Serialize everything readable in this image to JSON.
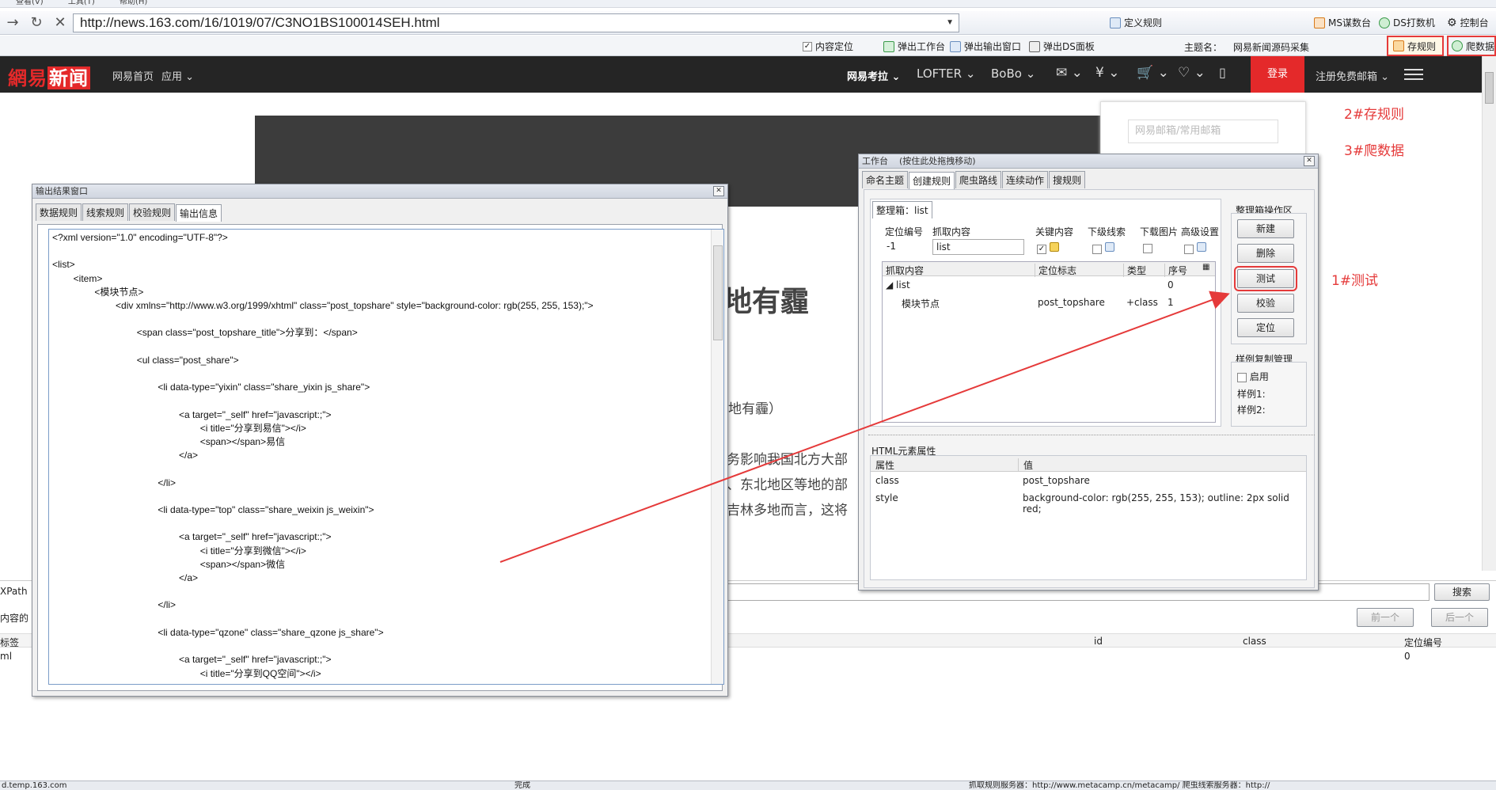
{
  "browser": {
    "menu_items": [
      "查看(V)",
      "工具(T)",
      "帮助(H)"
    ],
    "url": "http://news.163.com/16/1019/07/C3NO1BS100014SEH.html",
    "right_actions": [
      "定义规则",
      "MS谋数台",
      "DS打数机",
      "控制台"
    ],
    "toolbar2": {
      "content_locate": "内容定位",
      "popup_workbench": "弹出工作台",
      "popup_output": "弹出输出窗口",
      "popup_ds": "弹出DS面板",
      "theme_label": "主题名：",
      "theme_value": "网易新闻源码采集",
      "save_rule": "存规则",
      "crawl_data": "爬数据"
    }
  },
  "netease": {
    "logo_a": "網易",
    "logo_b": "新闻",
    "nav_left": [
      "网易首页",
      "应用"
    ],
    "nav_right": [
      "网易考拉",
      "LOFTER",
      "BoBo"
    ],
    "login": "登录",
    "register": "注册免费邮箱",
    "email_placeholder": "网易邮箱/常用邮箱",
    "headline_tail": "地有霾",
    "para1": "地有霾）",
    "para2": "务影响我国北方大部",
    "para3": "、东北地区等地的部",
    "para4": "吉林多地而言，这将"
  },
  "annotations": {
    "a1": "1#测试",
    "a2": "2#存规则",
    "a3": "3#爬数据"
  },
  "output_window": {
    "title": "输出结果窗口",
    "tabs": [
      "数据规则",
      "线索规则",
      "校验规则",
      "输出信息"
    ],
    "xml": "<?xml version=\"1.0\" encoding=\"UTF-8\"?>\n\n<list>\n        <item>\n                <模块节点>\n                        <div xmlns=\"http://www.w3.org/1999/xhtml\" class=\"post_topshare\" style=\"background-color: rgb(255, 255, 153);\">\n\n                                <span class=\"post_topshare_title\">分享到：</span>\n\n                                <ul class=\"post_share\">\n\n                                        <li data-type=\"yixin\" class=\"share_yixin js_share\">\n\n                                                <a target=\"_self\" href=\"javascript:;\">\n                                                        <i title=\"分享到易信\"></i>\n                                                        <span></span>易信\n                                                </a>\n\n                                        </li>\n\n                                        <li data-type=\"top\" class=\"share_weixin js_weixin\">\n\n                                                <a target=\"_self\" href=\"javascript:;\">\n                                                        <i title=\"分享到微信\"></i>\n                                                        <span></span>微信\n                                                </a>\n\n                                        </li>\n\n                                        <li data-type=\"qzone\" class=\"share_qzone js_share\">\n\n                                                <a target=\"_self\" href=\"javascript:;\">\n                                                        <i title=\"分享到QQ空间\"></i>"
  },
  "workbench": {
    "title": "工作台",
    "drag_hint": "(按住此处拖拽移动)",
    "tabs": [
      "命名主题",
      "创建规则",
      "爬虫路线",
      "连续动作",
      "搜规则"
    ],
    "box_tab": "整理箱：list",
    "headers": [
      "定位编号",
      "抓取内容",
      "关键内容",
      "下级线索",
      "下载图片",
      "高级设置"
    ],
    "loc_no": "-1",
    "grab_value": "list",
    "tree_headers": [
      "抓取内容",
      "定位标志",
      "类型",
      "序号"
    ],
    "tree_rows": [
      {
        "name": "list",
        "flag": "",
        "type": "",
        "idx": "0"
      },
      {
        "name": "模块节点",
        "flag": "post_topshare",
        "type": "+class",
        "idx": "1"
      }
    ],
    "ops_title": "整理箱操作区",
    "ops": [
      "新建",
      "删除",
      "测试",
      "校验",
      "定位"
    ],
    "sample_title": "样例复制管理",
    "enable": "启用",
    "sample1": "样例1:",
    "sample2": "样例2:",
    "attr_title": "HTML元素属性",
    "attr_headers": [
      "属性",
      "值"
    ],
    "attrs": [
      {
        "k": "class",
        "v": "post_topshare"
      },
      {
        "k": "style",
        "v": "background-color: rgb(255, 255, 153); outline: 2px solid red;"
      }
    ]
  },
  "lower": {
    "xpath_label": "XPath",
    "content_label": "内容的",
    "search": "搜索",
    "prev": "前一个",
    "next": "后一个",
    "col_tag": "标签",
    "col_id": "id",
    "col_class": "class",
    "col_locno": "定位编号",
    "row_tag": "ml",
    "row_locno": "0"
  },
  "status": {
    "left": "d.temp.163.com",
    "mid": "完成",
    "right": "抓取规则服务器：http://www.metacamp.cn/metacamp/   爬虫线索服务器：http://"
  }
}
